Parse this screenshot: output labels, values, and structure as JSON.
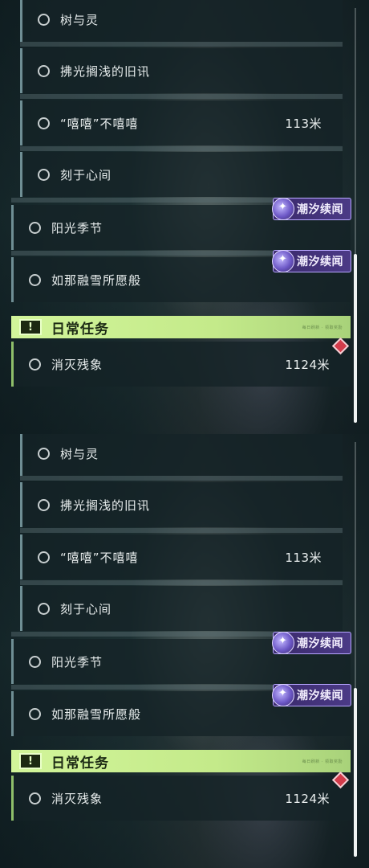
{
  "quests": [
    {
      "label": "树与灵",
      "distance": ""
    },
    {
      "label": "拂光搁浅的旧讯",
      "distance": ""
    },
    {
      "label": "“嘻嘻”不嘻嘻",
      "distance": "113米"
    },
    {
      "label": "刻于心间",
      "distance": ""
    },
    {
      "label": "阳光季节",
      "distance": ""
    },
    {
      "label": "如那融雪所愿般",
      "distance": ""
    }
  ],
  "event_badge": {
    "label": "潮汐续闻",
    "icon": "tidal-event-logo-icon"
  },
  "daily": {
    "header": "日常任务",
    "header_icon": "exclamation-icon",
    "fine_print": "每日刷新 · 领取奖励",
    "quest_label": "消灭残象",
    "quest_distance": "1124米",
    "marker_color": "#d33c4b"
  },
  "colors": {
    "daily_accent": "#c4ea8a",
    "event_purple": "#4b3a86"
  }
}
